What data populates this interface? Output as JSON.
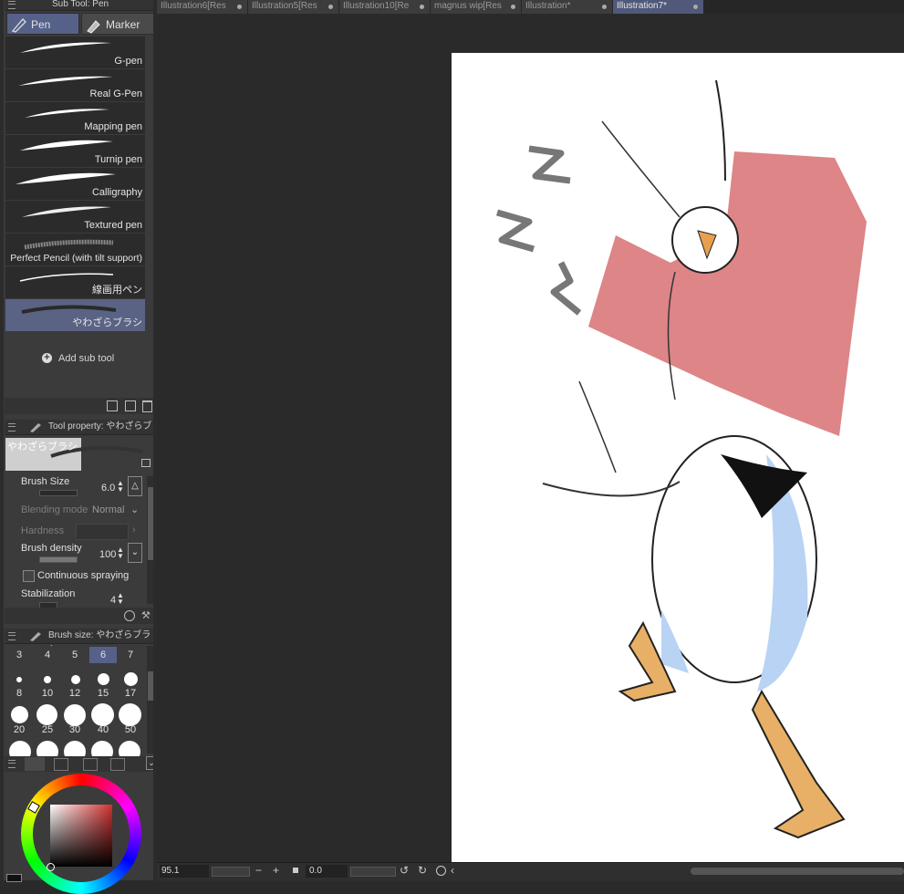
{
  "tabs": [
    {
      "label": "Illustration6[Res",
      "active": false
    },
    {
      "label": "Illustration5[Res",
      "active": false
    },
    {
      "label": "Illustration10[Re",
      "active": false
    },
    {
      "label": "magnus wip[Res",
      "active": false
    },
    {
      "label": "Illustration*",
      "active": false
    },
    {
      "label": "Illustration7*",
      "active": true
    }
  ],
  "subtool": {
    "header": "Sub Tool: Pen",
    "groups": [
      "Pen",
      "Marker"
    ],
    "items": [
      "G-pen",
      "Real G-Pen",
      "Mapping pen",
      "Turnip pen",
      "Calligraphy",
      "Textured pen",
      "Perfect Pencil (with tilt support)",
      "線画用ペン",
      "やわざらブラシ"
    ],
    "active_item": "やわざらブラシ",
    "add_label": "Add sub tool"
  },
  "tool_property": {
    "header": "Tool property: やわざらブラシ",
    "preview_label": "やわざらブラシ",
    "brush_size_label": "Brush Size",
    "brush_size_value": "6.0",
    "blending_label": "Blending mode",
    "blending_value": "Normal",
    "hardness_label": "Hardness",
    "density_label": "Brush density",
    "density_value": "100",
    "continuous_label": "Continuous spraying",
    "stabilization_label": "Stabilization",
    "stabilization_value": "4"
  },
  "brush_size_panel": {
    "header": "Brush size: やわざらブラシ",
    "top_row": [
      "3",
      "4",
      "5",
      "6",
      "7"
    ],
    "selected": "6",
    "row2": [
      "8",
      "10",
      "12",
      "15",
      "17"
    ],
    "row3": [
      "20",
      "25",
      "30",
      "40",
      "50"
    ]
  },
  "status_bar": {
    "zoom": "95.1",
    "rotation": "0.0"
  },
  "colors": {
    "accent": "#56618a",
    "canvas_bg": "#2a2a2a",
    "paper": "#ffffff",
    "jacket": "#d9787a",
    "body_shade": "#b9d3f5",
    "feet": "#e8b066"
  }
}
